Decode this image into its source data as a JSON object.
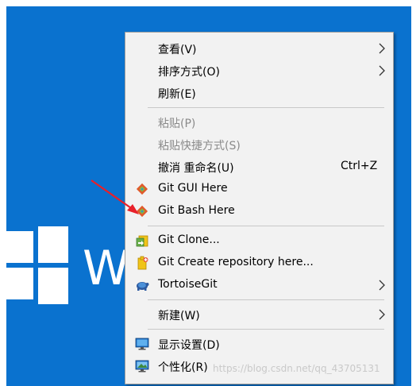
{
  "desktop": {
    "background_color": "#0a72cf",
    "logo_letter": "W"
  },
  "context_menu": {
    "groups": [
      [
        {
          "label": "查看(V)",
          "submenu": true
        },
        {
          "label": "排序方式(O)",
          "submenu": true
        },
        {
          "label": "刷新(E)"
        }
      ],
      [
        {
          "label": "粘贴(P)",
          "disabled": true
        },
        {
          "label": "粘贴快捷方式(S)",
          "disabled": true
        },
        {
          "label": "撤消 重命名(U)",
          "shortcut": "Ctrl+Z"
        },
        {
          "label": "Git GUI Here",
          "icon": "git-gui-icon"
        },
        {
          "label": "Git Bash Here",
          "icon": "git-bash-icon"
        }
      ],
      [
        {
          "label": "Git Clone...",
          "icon": "git-clone-icon"
        },
        {
          "label": "Git Create repository here...",
          "icon": "git-create-repo-icon"
        },
        {
          "label": "TortoiseGit",
          "icon": "tortoisegit-icon",
          "submenu": true
        }
      ],
      [
        {
          "label": "新建(W)",
          "submenu": true
        }
      ],
      [
        {
          "label": "显示设置(D)",
          "icon": "display-settings-icon"
        },
        {
          "label": "个性化(R)",
          "icon": "personalize-icon"
        }
      ]
    ]
  },
  "watermark": "https://blog.csdn.net/qq_43705131",
  "annotation_arrow_color": "#e8202a"
}
